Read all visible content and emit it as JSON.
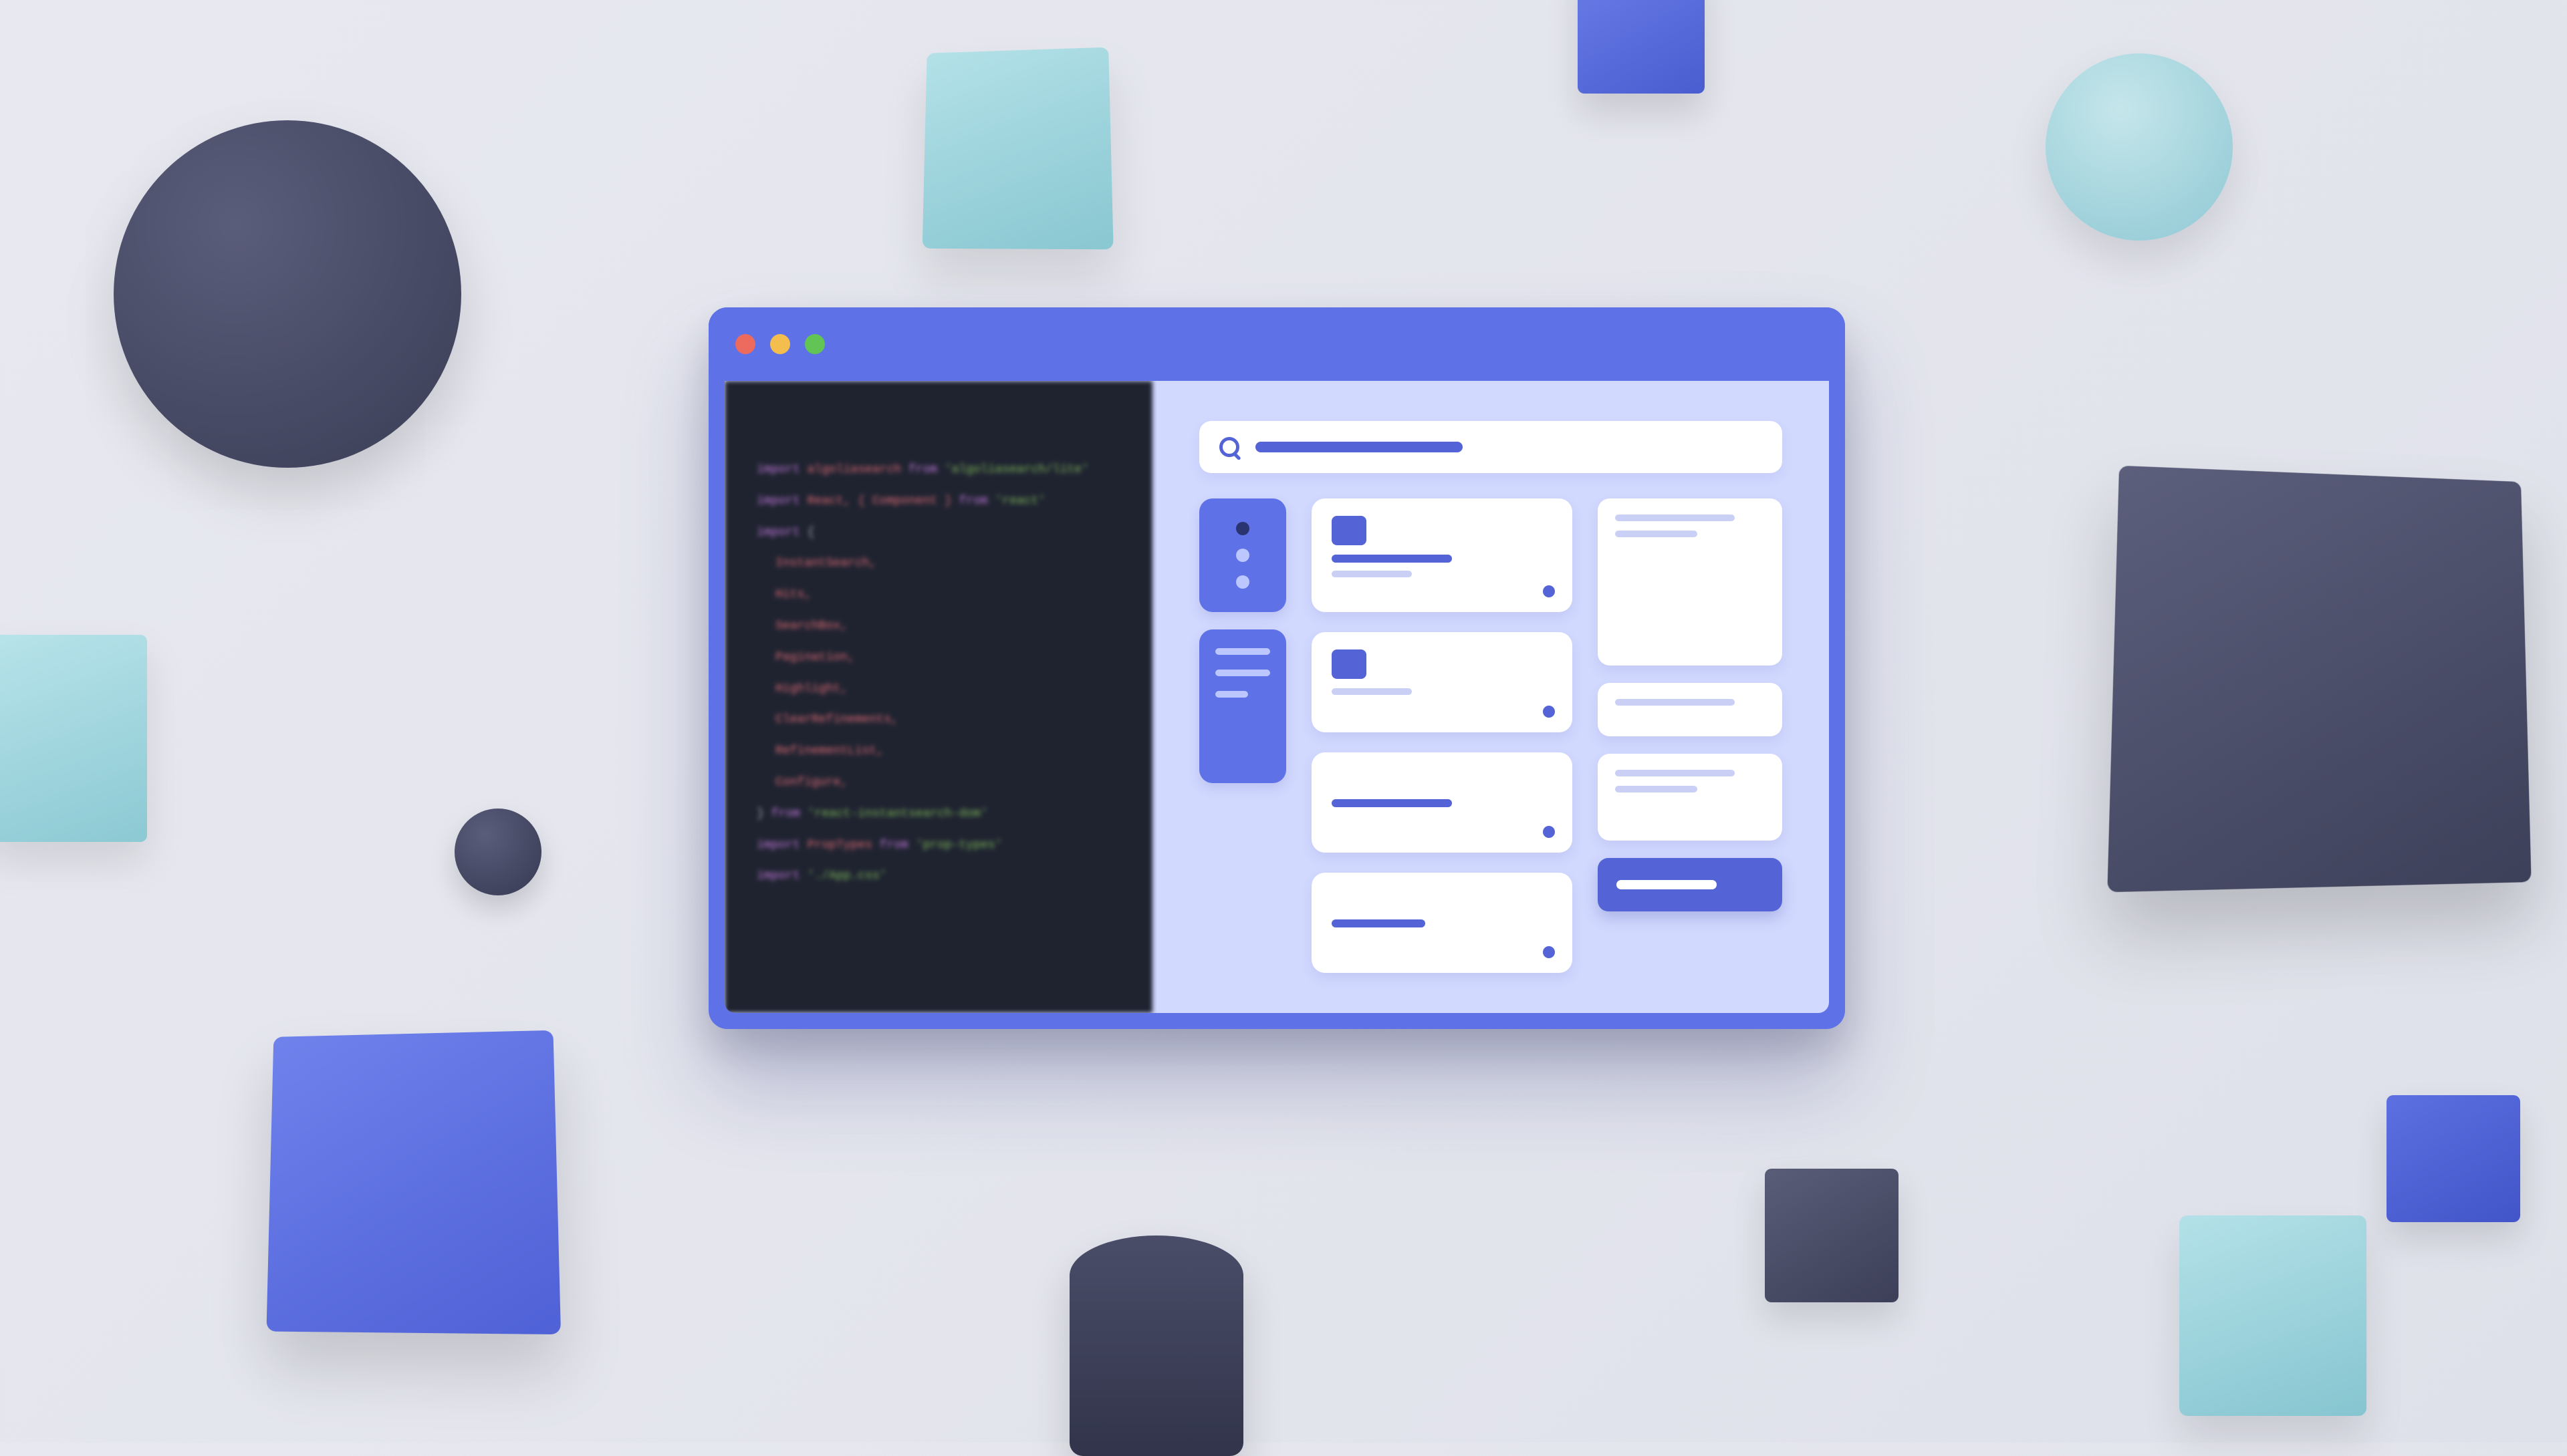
{
  "colors": {
    "window_accent": "#5f71e6",
    "panel_bg": "#d2d9ff",
    "code_bg": "#1f2330",
    "primary": "#5463d6"
  },
  "code": {
    "lines": [
      {
        "kw": "import",
        "id": "algoliasearch",
        "from": "from",
        "mod": "'algoliasearch/lite'"
      },
      {
        "kw": "import",
        "id": "React, { Component }",
        "from": "from",
        "mod": "'react'"
      },
      {
        "kw": "import",
        "punc": "{"
      },
      {
        "plain": "InstantSearch,"
      },
      {
        "plain": "Hits,"
      },
      {
        "plain": "SearchBox,"
      },
      {
        "plain": "Pagination,"
      },
      {
        "plain": "Highlight,"
      },
      {
        "plain": "ClearRefinements,"
      },
      {
        "plain": "RefinementList,"
      },
      {
        "plain": "Configure,"
      },
      {
        "punc": "}",
        "from": "from",
        "mod": "'react-instantsearch-dom'"
      },
      {
        "kw": "import",
        "id": "PropTypes",
        "from": "from",
        "mod": "'prop-types'"
      },
      {
        "kw": "import",
        "mod": "'./App.css'"
      }
    ]
  },
  "ui": {
    "search_placeholder": "",
    "sidebar_dots": 3,
    "sidebar_lines": 3,
    "mid_cards": 4,
    "right_cards": 3,
    "cta_label": ""
  }
}
